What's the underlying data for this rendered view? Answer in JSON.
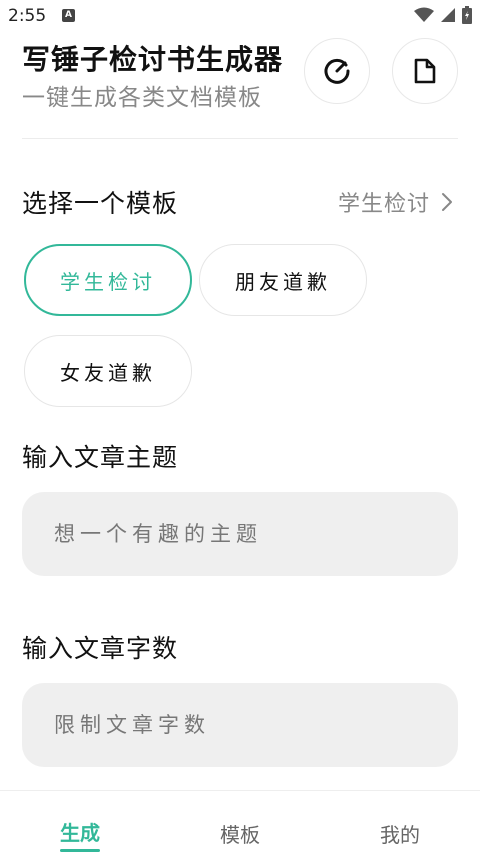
{
  "status_bar": {
    "time": "2:55",
    "notification_glyph": "A",
    "icons": [
      "wifi-icon",
      "signal-icon",
      "battery-icon"
    ]
  },
  "header": {
    "title": "写锤子检讨书生成器",
    "subtitle": "一键生成各类文档模板",
    "buttons": [
      "gauge-icon",
      "document-icon"
    ]
  },
  "template_section": {
    "title": "选择一个模板",
    "selected_value": "学生检讨",
    "options": [
      {
        "label": "学生检讨",
        "selected": true
      },
      {
        "label": "朋友道歉",
        "selected": false
      },
      {
        "label": "女友道歉",
        "selected": false
      }
    ]
  },
  "topic_section": {
    "title": "输入文章主题",
    "value": "",
    "placeholder": "想一个有趣的主题"
  },
  "wordcount_section": {
    "title": "输入文章字数",
    "value": "",
    "placeholder": "限制文章字数"
  },
  "tabbar": {
    "tabs": [
      {
        "label": "生成",
        "active": true
      },
      {
        "label": "模板",
        "active": false
      },
      {
        "label": "我的",
        "active": false
      }
    ]
  },
  "colors": {
    "accent": "#32b899",
    "muted_text": "#888888",
    "input_bg": "#efefef"
  }
}
